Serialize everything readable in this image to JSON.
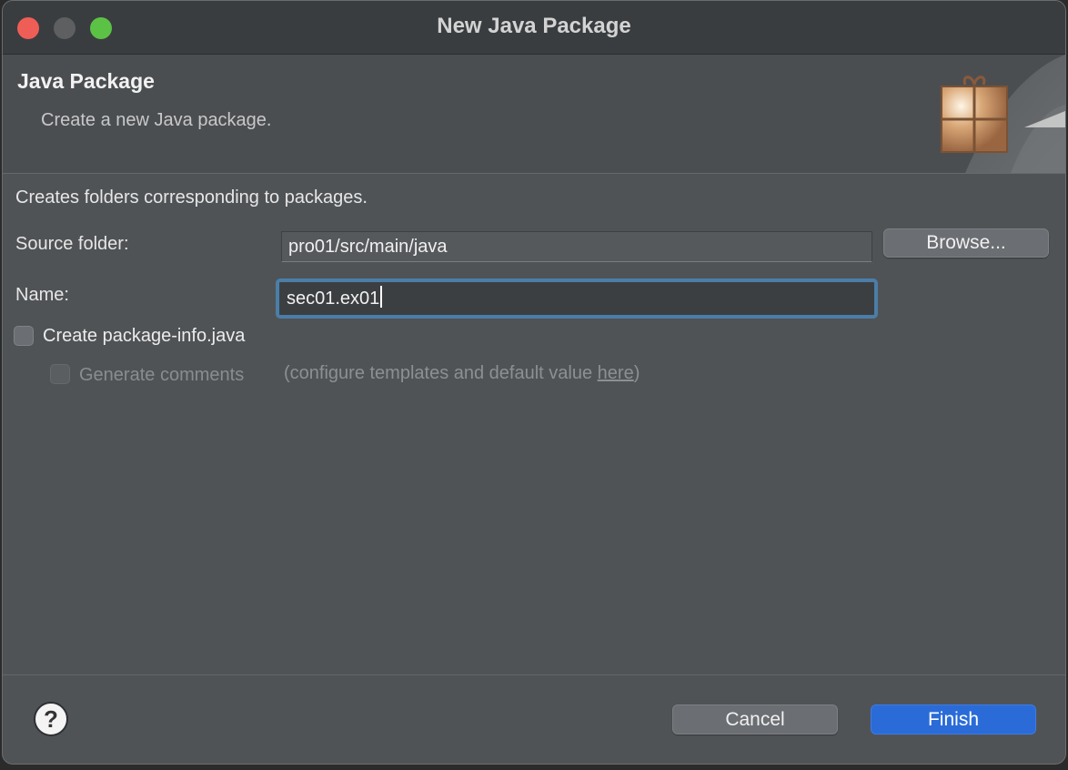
{
  "window": {
    "title": "New Java Package"
  },
  "banner": {
    "title": "Java Package",
    "description": "Create a new Java package.",
    "icon": "package-icon"
  },
  "form": {
    "description": "Creates folders corresponding to packages.",
    "source_folder_label": "Source folder:",
    "source_folder_value": "pro01/src/main/java",
    "browse_label": "Browse...",
    "name_label": "Name:",
    "name_value": "sec01.ex01",
    "create_package_info_label": "Create package-info.java",
    "generate_comments_label": "Generate comments",
    "hint_prefix": "(configure templates and default value ",
    "hint_link": "here",
    "hint_suffix": ")"
  },
  "footer": {
    "help_glyph": "?",
    "cancel_label": "Cancel",
    "finish_label": "Finish"
  },
  "colors": {
    "accent": "#2a6bd8",
    "focus_ring": "#4a7ea8",
    "close": "#ee5e57",
    "zoom": "#5cc245"
  }
}
